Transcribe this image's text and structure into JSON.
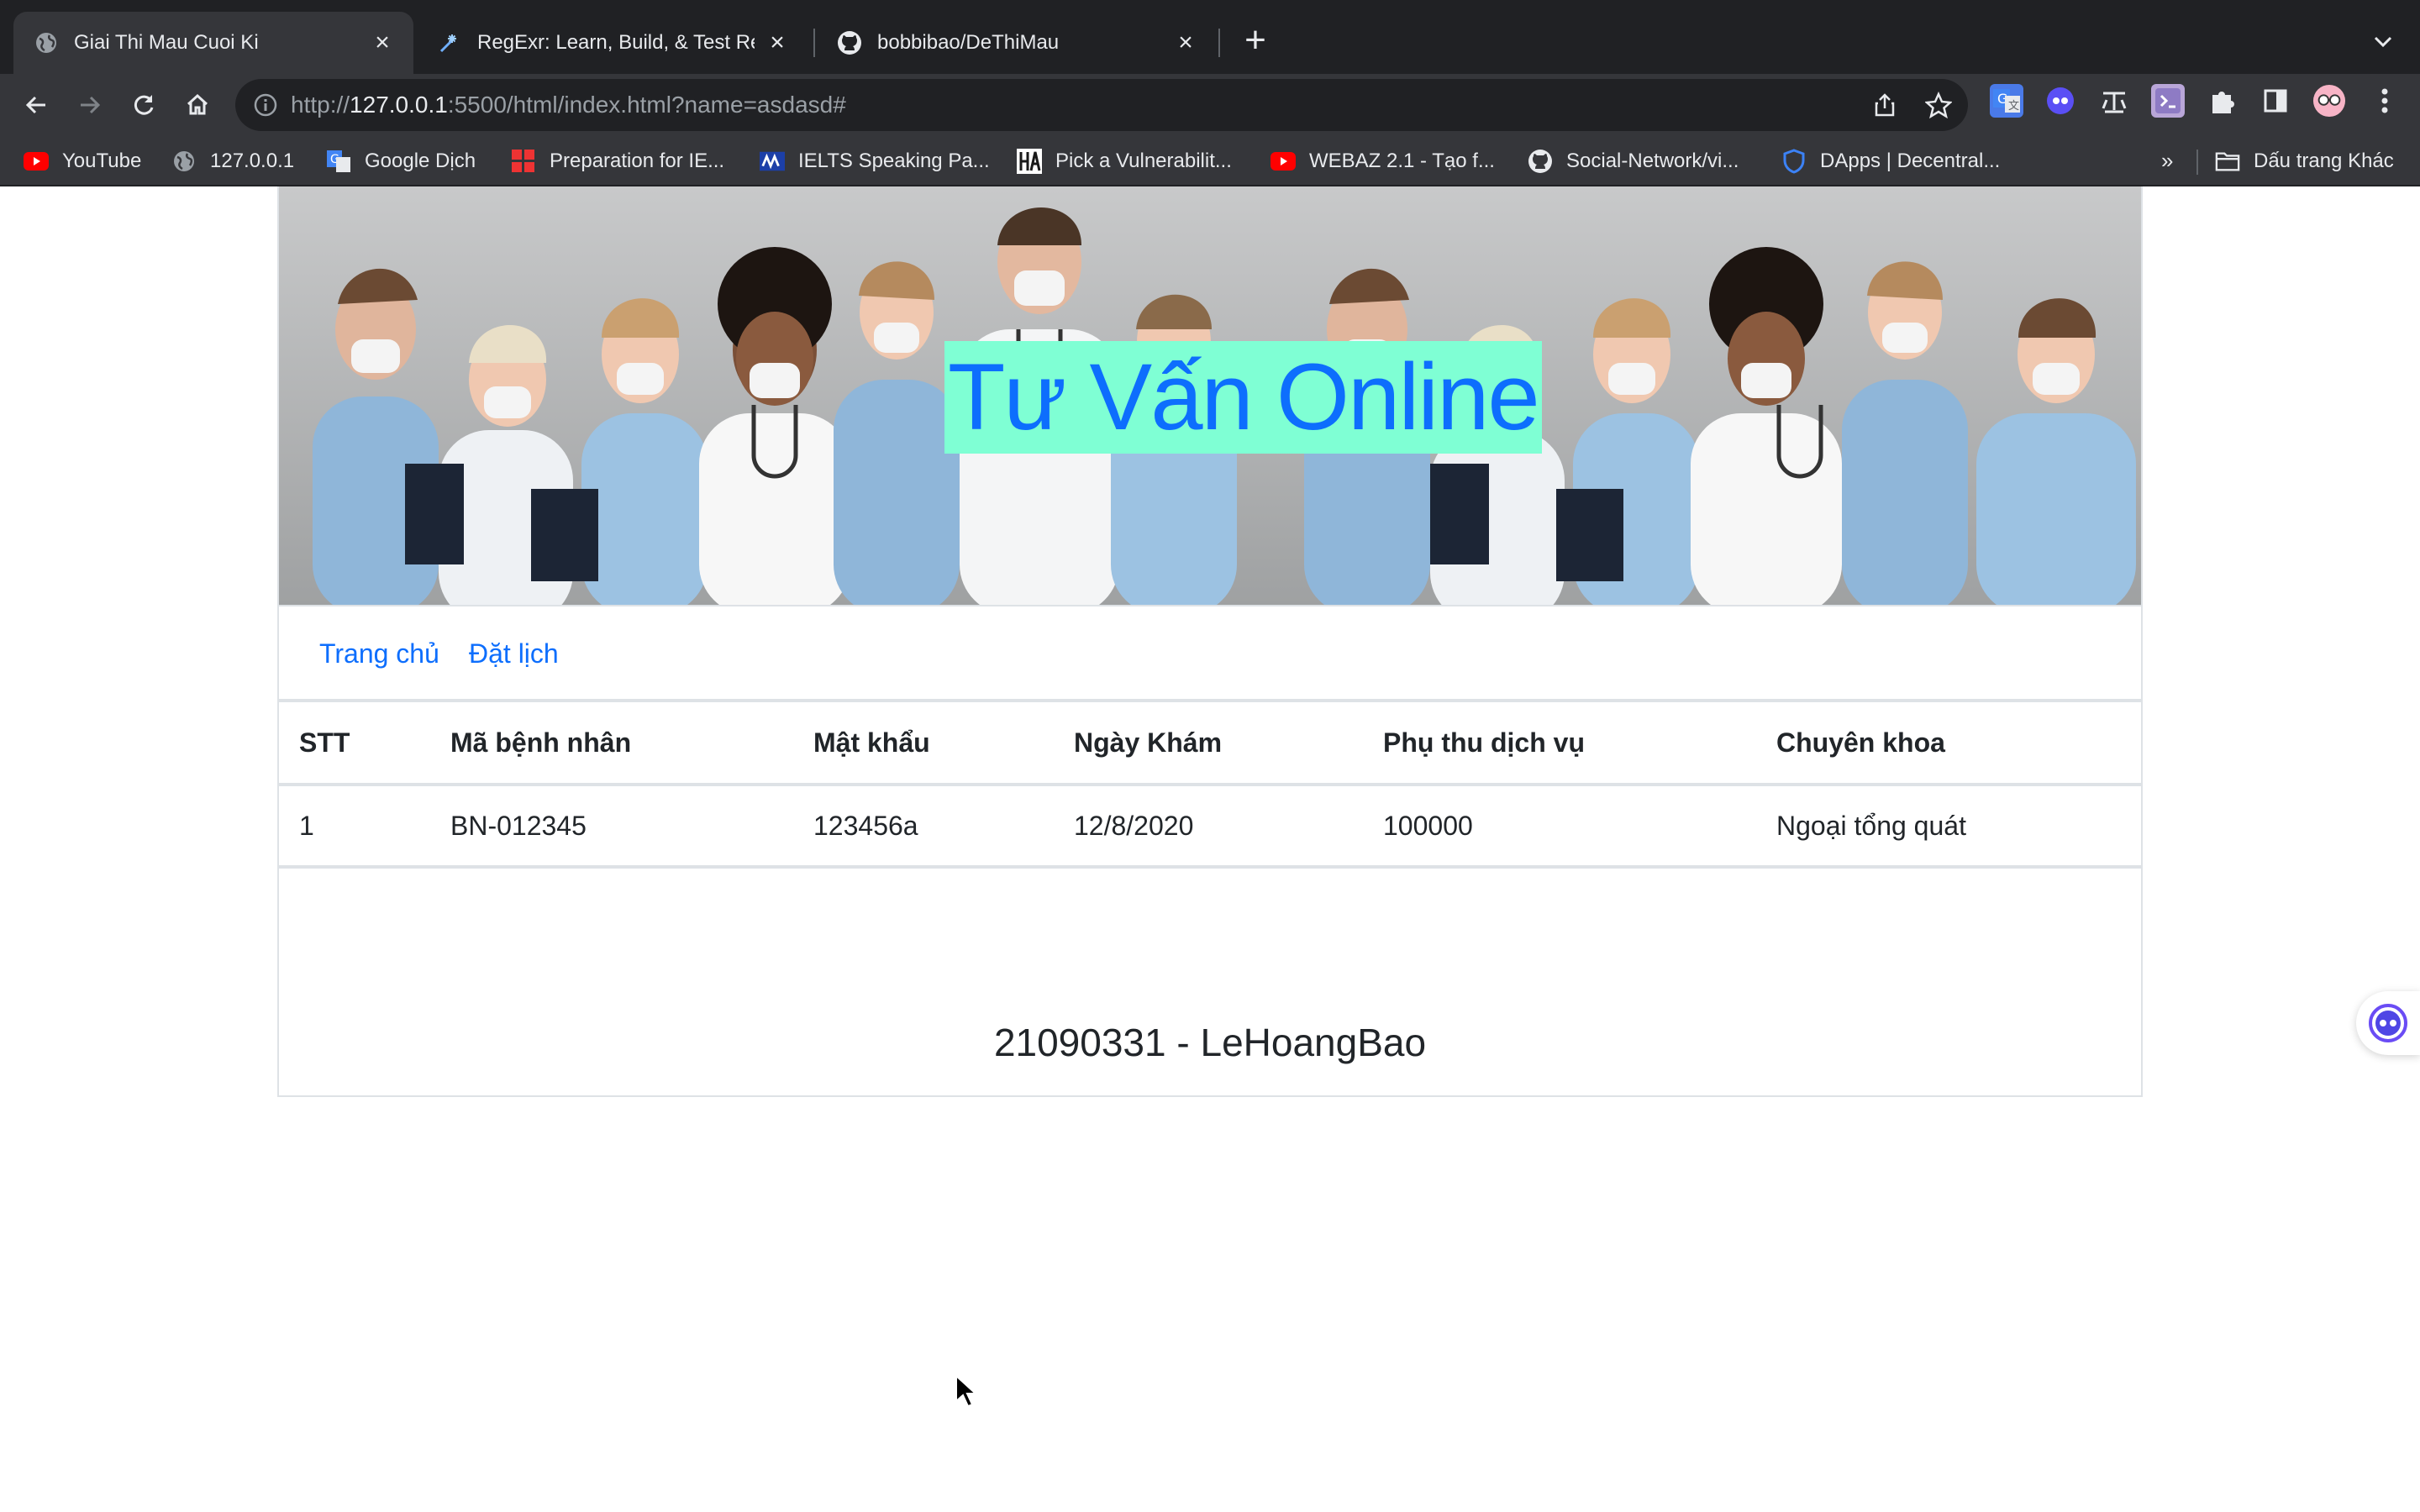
{
  "browser": {
    "tabs": [
      {
        "title": "Giai Thi Mau Cuoi Ki",
        "active": true,
        "favicon": "globe-icon"
      },
      {
        "title": "RegExr: Learn, Build, & Test Re",
        "active": false,
        "favicon": "regexr-icon"
      },
      {
        "title": "bobbibao/DeThiMau",
        "active": false,
        "favicon": "github-icon"
      }
    ],
    "url": {
      "scheme": "http://",
      "host": "127.0.0.1",
      "rest": ":5500/html/index.html?name=asdasd#"
    },
    "bookmarks": [
      {
        "label": "YouTube",
        "icon": "youtube-icon"
      },
      {
        "label": "127.0.0.1",
        "icon": "globe-icon"
      },
      {
        "label": "Google Dịch",
        "icon": "google-translate-icon"
      },
      {
        "label": "Preparation for IE...",
        "icon": "squares-icon"
      },
      {
        "label": "IELTS Speaking Pa...",
        "icon": "ielts-icon"
      },
      {
        "label": "Pick a Vulnerabilit...",
        "icon": "ha-icon"
      },
      {
        "label": "WEBAZ 2.1 - Tạo f...",
        "icon": "youtube-icon"
      },
      {
        "label": "Social-Network/vi...",
        "icon": "github-icon"
      },
      {
        "label": "DApps | Decentral...",
        "icon": "shield-icon"
      }
    ],
    "bookmarks_more": "»",
    "other_bookmarks": "Dấu trang Khác"
  },
  "page": {
    "banner_title": "Tư Vấn Online",
    "nav": [
      {
        "label": "Trang chủ"
      },
      {
        "label": "Đặt lịch"
      }
    ],
    "table": {
      "headers": [
        "STT",
        "Mã bệnh nhân",
        "Mật khẩu",
        "Ngày Khám",
        "Phụ thu dịch vụ",
        "Chuyên khoa"
      ],
      "rows": [
        [
          "1",
          "BN-012345",
          "123456a",
          "12/8/2020",
          "100000",
          "Ngoại tổng quát"
        ]
      ]
    },
    "footer": "21090331 - LeHoangBao"
  },
  "colors": {
    "title_bg": "#7fffd4",
    "link": "#0d6efd",
    "chrome_dark": "#202124",
    "chrome_toolbar": "#35363a"
  }
}
